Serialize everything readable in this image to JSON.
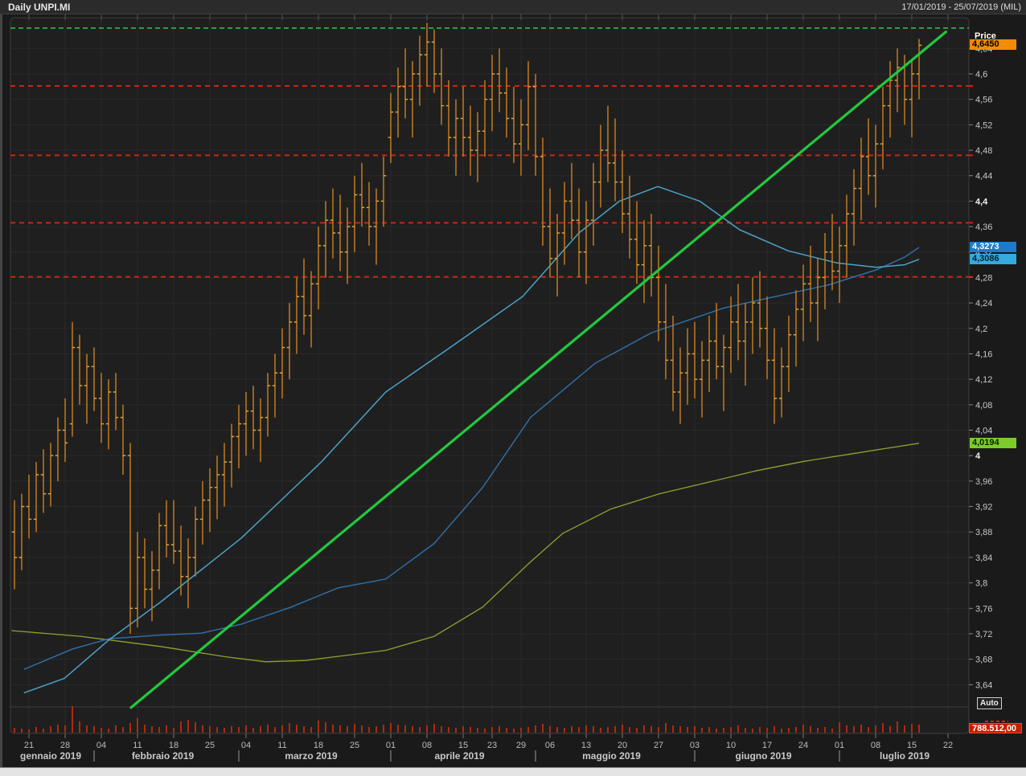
{
  "titlebar": {
    "title": "Daily UNPI.MI",
    "range": "17/01/2019 - 25/07/2019 (MIL)"
  },
  "readouts": {
    "price_label": "Price",
    "last_price": "4,6450",
    "ma_steel": "4,3273",
    "ma_cyan": "4,3086",
    "ma_olive": "4,0194",
    "last_volume": "788.512,00"
  },
  "controls": {
    "auto": "Auto"
  },
  "colors": {
    "plot_bg": "#1f1f1f",
    "frame": "#3d3d3d",
    "grid": "#2a2a2a",
    "bar": "#c07a1e",
    "bar_tick": "#dca43c",
    "volume": "#ae2a10",
    "ma_cyan": "#4aa3c8",
    "ma_steel": "#2e6da4",
    "ma_olive": "#8fa32f",
    "trend": "#21c93e",
    "green_dashed": "#2f9e41",
    "red_dashed": "#c62814",
    "axis_text": "#c8c8c8",
    "tick_mark": "#888888"
  },
  "chart_data": {
    "type": "ohlc",
    "title": "Daily UNPI.MI",
    "x_range": "17/01/2019 - 25/07/2019",
    "y_axis": {
      "min": 3.64,
      "max": 4.64,
      "ticks": [
        {
          "v": 4.64,
          "t": "4,64"
        },
        {
          "v": 4.6,
          "t": "4,6"
        },
        {
          "v": 4.56,
          "t": "4,56"
        },
        {
          "v": 4.52,
          "t": "4,52"
        },
        {
          "v": 4.48,
          "t": "4,48"
        },
        {
          "v": 4.44,
          "t": "4,44"
        },
        {
          "v": 4.4,
          "t": "4,4",
          "b": 1
        },
        {
          "v": 4.36,
          "t": "4,36"
        },
        {
          "v": 4.32,
          "t": "4,32"
        },
        {
          "v": 4.28,
          "t": "4,28"
        },
        {
          "v": 4.24,
          "t": "4,24"
        },
        {
          "v": 4.2,
          "t": "4,2"
        },
        {
          "v": 4.16,
          "t": "4,16"
        },
        {
          "v": 4.12,
          "t": "4,12"
        },
        {
          "v": 4.08,
          "t": "4,08"
        },
        {
          "v": 4.04,
          "t": "4,04"
        },
        {
          "v": 4.0,
          "t": "4",
          "b": 1
        },
        {
          "v": 3.96,
          "t": "3,96"
        },
        {
          "v": 3.92,
          "t": "3,92"
        },
        {
          "v": 3.88,
          "t": "3,88"
        },
        {
          "v": 3.84,
          "t": "3,84"
        },
        {
          "v": 3.8,
          "t": "3,8"
        },
        {
          "v": 3.76,
          "t": "3,76"
        },
        {
          "v": 3.72,
          "t": "3,72"
        },
        {
          "v": 3.68,
          "t": "3,68"
        },
        {
          "v": 3.64,
          "t": "3,64"
        }
      ]
    },
    "x_axis": {
      "week_ticks": [
        [
          "21",
          2
        ],
        [
          "28",
          7
        ],
        [
          "04",
          12
        ],
        [
          "11",
          17
        ],
        [
          "18",
          22
        ],
        [
          "25",
          27
        ],
        [
          "04",
          32
        ],
        [
          "11",
          37
        ],
        [
          "18",
          42
        ],
        [
          "25",
          47
        ],
        [
          "01",
          52
        ],
        [
          "08",
          57
        ],
        [
          "15",
          62
        ],
        [
          "23",
          66
        ],
        [
          "29",
          70
        ],
        [
          "06",
          74
        ],
        [
          "13",
          79
        ],
        [
          "20",
          84
        ],
        [
          "27",
          89
        ],
        [
          "03",
          94
        ],
        [
          "10",
          99
        ],
        [
          "17",
          104
        ],
        [
          "24",
          109
        ],
        [
          "01",
          114
        ],
        [
          "08",
          119
        ],
        [
          "15",
          124
        ],
        [
          "22",
          129
        ]
      ],
      "months": [
        {
          "label": "gennaio 2019",
          "start": 0,
          "end": 10
        },
        {
          "label": "febbraio 2019",
          "start": 11,
          "end": 30
        },
        {
          "label": "marzo 2019",
          "start": 31,
          "end": 51
        },
        {
          "label": "aprile 2019",
          "start": 52,
          "end": 71
        },
        {
          "label": "maggio 2019",
          "start": 72,
          "end": 93
        },
        {
          "label": "giugno 2019",
          "start": 94,
          "end": 113
        },
        {
          "label": "luglio 2019",
          "start": 114,
          "end": 132
        }
      ],
      "total_slots": 133
    },
    "bars": [
      [
        3.88,
        3.93,
        3.79,
        3.84
      ],
      [
        3.84,
        3.94,
        3.82,
        3.92
      ],
      [
        3.92,
        3.97,
        3.87,
        3.9
      ],
      [
        3.9,
        3.99,
        3.88,
        3.97
      ],
      [
        3.97,
        4.01,
        3.91,
        3.94
      ],
      [
        3.94,
        4.02,
        3.92,
        4.0
      ],
      [
        4.0,
        4.06,
        3.96,
        4.04
      ],
      [
        4.04,
        4.09,
        3.99,
        4.02
      ],
      [
        4.05,
        4.21,
        4.03,
        4.17
      ],
      [
        4.17,
        4.19,
        4.08,
        4.11
      ],
      [
        4.11,
        4.16,
        4.05,
        4.14
      ],
      [
        4.14,
        4.17,
        4.07,
        4.09
      ],
      [
        4.09,
        4.13,
        4.02,
        4.05
      ],
      [
        4.05,
        4.12,
        4.01,
        4.1
      ],
      [
        4.1,
        4.13,
        4.04,
        4.06
      ],
      [
        4.06,
        4.08,
        3.97,
        4.0
      ],
      [
        4.0,
        4.02,
        3.72,
        3.76
      ],
      [
        3.76,
        3.88,
        3.73,
        3.84
      ],
      [
        3.84,
        3.87,
        3.76,
        3.79
      ],
      [
        3.79,
        3.85,
        3.74,
        3.82
      ],
      [
        3.82,
        3.91,
        3.79,
        3.89
      ],
      [
        3.89,
        3.93,
        3.84,
        3.86
      ],
      [
        3.86,
        3.93,
        3.83,
        3.85
      ],
      [
        3.85,
        3.89,
        3.78,
        3.81
      ],
      [
        3.81,
        3.87,
        3.76,
        3.84
      ],
      [
        3.84,
        3.92,
        3.81,
        3.9
      ],
      [
        3.9,
        3.96,
        3.86,
        3.93
      ],
      [
        3.93,
        3.98,
        3.88,
        3.95
      ],
      [
        3.95,
        4.0,
        3.9,
        3.97
      ],
      [
        3.97,
        4.02,
        3.92,
        3.99
      ],
      [
        3.99,
        4.05,
        3.95,
        4.03
      ],
      [
        4.03,
        4.08,
        3.98,
        4.05
      ],
      [
        4.05,
        4.1,
        4.0,
        4.07
      ],
      [
        4.07,
        4.11,
        4.01,
        4.04
      ],
      [
        4.04,
        4.09,
        3.99,
        4.06
      ],
      [
        4.06,
        4.13,
        4.03,
        4.11
      ],
      [
        4.11,
        4.16,
        4.06,
        4.13
      ],
      [
        4.13,
        4.2,
        4.09,
        4.17
      ],
      [
        4.17,
        4.24,
        4.12,
        4.21
      ],
      [
        4.21,
        4.28,
        4.16,
        4.25
      ],
      [
        4.25,
        4.31,
        4.19,
        4.22
      ],
      [
        4.22,
        4.29,
        4.17,
        4.27
      ],
      [
        4.27,
        4.36,
        4.23,
        4.33
      ],
      [
        4.33,
        4.4,
        4.28,
        4.37
      ],
      [
        4.37,
        4.42,
        4.31,
        4.35
      ],
      [
        4.35,
        4.41,
        4.29,
        4.32
      ],
      [
        4.32,
        4.39,
        4.27,
        4.36
      ],
      [
        4.36,
        4.44,
        4.32,
        4.41
      ],
      [
        4.41,
        4.46,
        4.36,
        4.39
      ],
      [
        4.39,
        4.43,
        4.33,
        4.36
      ],
      [
        4.36,
        4.42,
        4.3,
        4.4
      ],
      [
        4.4,
        4.47,
        4.36,
        4.44
      ],
      [
        4.5,
        4.57,
        4.46,
        4.54
      ],
      [
        4.54,
        4.61,
        4.5,
        4.58
      ],
      [
        4.58,
        4.64,
        4.53,
        4.56
      ],
      [
        4.56,
        4.62,
        4.5,
        4.6
      ],
      [
        4.6,
        4.66,
        4.55,
        4.63
      ],
      [
        4.63,
        4.68,
        4.58,
        4.65
      ],
      [
        4.65,
        4.67,
        4.57,
        4.6
      ],
      [
        4.6,
        4.64,
        4.52,
        4.55
      ],
      [
        4.55,
        4.59,
        4.47,
        4.5
      ],
      [
        4.5,
        4.56,
        4.44,
        4.53
      ],
      [
        4.53,
        4.58,
        4.47,
        4.5
      ],
      [
        4.5,
        4.55,
        4.44,
        4.48
      ],
      [
        4.48,
        4.54,
        4.43,
        4.51
      ],
      [
        4.51,
        4.59,
        4.47,
        4.56
      ],
      [
        4.56,
        4.63,
        4.51,
        4.6
      ],
      [
        4.6,
        4.64,
        4.54,
        4.57
      ],
      [
        4.57,
        4.61,
        4.5,
        4.53
      ],
      [
        4.53,
        4.58,
        4.46,
        4.49
      ],
      [
        4.49,
        4.56,
        4.44,
        4.52
      ],
      [
        4.52,
        4.62,
        4.48,
        4.58
      ],
      [
        4.58,
        4.6,
        4.44,
        4.47
      ],
      [
        4.47,
        4.5,
        4.33,
        4.36
      ],
      [
        4.36,
        4.42,
        4.28,
        4.31
      ],
      [
        4.31,
        4.38,
        4.25,
        4.35
      ],
      [
        4.35,
        4.43,
        4.3,
        4.4
      ],
      [
        4.4,
        4.46,
        4.34,
        4.37
      ],
      [
        4.37,
        4.42,
        4.28,
        4.32
      ],
      [
        4.32,
        4.4,
        4.27,
        4.37
      ],
      [
        4.37,
        4.46,
        4.33,
        4.43
      ],
      [
        4.43,
        4.52,
        4.39,
        4.48
      ],
      [
        4.48,
        4.55,
        4.43,
        4.46
      ],
      [
        4.46,
        4.53,
        4.4,
        4.43
      ],
      [
        4.43,
        4.48,
        4.35,
        4.38
      ],
      [
        4.38,
        4.44,
        4.31,
        4.34
      ],
      [
        4.34,
        4.4,
        4.27,
        4.3
      ],
      [
        4.3,
        4.37,
        4.24,
        4.33
      ],
      [
        4.33,
        4.38,
        4.25,
        4.28
      ],
      [
        4.28,
        4.33,
        4.18,
        4.21
      ],
      [
        4.21,
        4.27,
        4.12,
        4.15
      ],
      [
        4.15,
        4.22,
        4.07,
        4.1
      ],
      [
        4.1,
        4.17,
        4.05,
        4.13
      ],
      [
        4.13,
        4.2,
        4.08,
        4.16
      ],
      [
        4.16,
        4.21,
        4.09,
        4.12
      ],
      [
        4.12,
        4.18,
        4.06,
        4.15
      ],
      [
        4.15,
        4.22,
        4.1,
        4.18
      ],
      [
        4.18,
        4.24,
        4.12,
        4.14
      ],
      [
        4.14,
        4.19,
        4.07,
        4.17
      ],
      [
        4.17,
        4.25,
        4.13,
        4.21
      ],
      [
        4.21,
        4.27,
        4.15,
        4.18
      ],
      [
        4.18,
        4.24,
        4.11,
        4.21
      ],
      [
        4.21,
        4.28,
        4.16,
        4.24
      ],
      [
        4.24,
        4.29,
        4.17,
        4.2
      ],
      [
        4.2,
        4.25,
        4.12,
        4.15
      ],
      [
        4.15,
        4.2,
        4.05,
        4.09
      ],
      [
        4.09,
        4.17,
        4.06,
        4.14
      ],
      [
        4.14,
        4.22,
        4.1,
        4.19
      ],
      [
        4.19,
        4.26,
        4.14,
        4.23
      ],
      [
        4.23,
        4.3,
        4.18,
        4.27
      ],
      [
        4.27,
        4.33,
        4.21,
        4.24
      ],
      [
        4.24,
        4.31,
        4.18,
        4.28
      ],
      [
        4.28,
        4.35,
        4.23,
        4.32
      ],
      [
        4.32,
        4.38,
        4.26,
        4.29
      ],
      [
        4.29,
        4.36,
        4.24,
        4.33
      ],
      [
        4.33,
        4.41,
        4.28,
        4.38
      ],
      [
        4.38,
        4.45,
        4.33,
        4.42
      ],
      [
        4.42,
        4.5,
        4.37,
        4.47
      ],
      [
        4.47,
        4.53,
        4.41,
        4.44
      ],
      [
        4.44,
        4.52,
        4.39,
        4.49
      ],
      [
        4.49,
        4.58,
        4.45,
        4.55
      ],
      [
        4.55,
        4.62,
        4.5,
        4.59
      ],
      [
        4.59,
        4.64,
        4.54,
        4.61
      ],
      [
        4.61,
        4.63,
        4.52,
        4.56
      ],
      [
        4.56,
        4.62,
        4.5,
        4.6
      ],
      [
        4.6,
        4.655,
        4.56,
        4.645
      ]
    ],
    "volume_rel": [
      6,
      5,
      4,
      7,
      5,
      8,
      10,
      9,
      33,
      14,
      9,
      8,
      6,
      5,
      9,
      7,
      12,
      18,
      10,
      8,
      7,
      9,
      6,
      14,
      16,
      13,
      9,
      8,
      7,
      6,
      8,
      7,
      9,
      6,
      8,
      10,
      7,
      9,
      12,
      10,
      8,
      7,
      15,
      13,
      10,
      9,
      8,
      11,
      9,
      7,
      8,
      10,
      12,
      10,
      9,
      8,
      7,
      9,
      11,
      8,
      7,
      6,
      8,
      7,
      6,
      5,
      7,
      8,
      6,
      5,
      6,
      7,
      9,
      11,
      8,
      7,
      6,
      8,
      7,
      9,
      8,
      6,
      7,
      8,
      10,
      7,
      6,
      9,
      8,
      7,
      12,
      9,
      8,
      7,
      8,
      6,
      7,
      5,
      6,
      7,
      9,
      6,
      5,
      7,
      6,
      8,
      5,
      6,
      7,
      10,
      8,
      6,
      7,
      5,
      13,
      9,
      8,
      10,
      7,
      9,
      12,
      8,
      14,
      9,
      11,
      10
    ],
    "overlays": {
      "ma_cyan": {
        "last_label": "4,3086",
        "points": [
          [
            1.3,
            3.627
          ],
          [
            6.9,
            3.65
          ],
          [
            13,
            3.71
          ],
          [
            20.2,
            3.77
          ],
          [
            31.3,
            3.87
          ],
          [
            42.4,
            3.99
          ],
          [
            51.3,
            4.1
          ],
          [
            60.2,
            4.17
          ],
          [
            70.2,
            4.25
          ],
          [
            78,
            4.35
          ],
          [
            83.6,
            4.4
          ],
          [
            88.9,
            4.423
          ],
          [
            94.7,
            4.4
          ],
          [
            100.2,
            4.355
          ],
          [
            106.9,
            4.322
          ],
          [
            113.6,
            4.303
          ],
          [
            119.1,
            4.296
          ],
          [
            123,
            4.3
          ],
          [
            125,
            4.3086
          ]
        ]
      },
      "ma_steel": {
        "last_label": "4,3273",
        "points": [
          [
            1.3,
            3.664
          ],
          [
            8,
            3.696
          ],
          [
            13,
            3.712
          ],
          [
            20.2,
            3.718
          ],
          [
            25.8,
            3.721
          ],
          [
            31.3,
            3.735
          ],
          [
            38,
            3.761
          ],
          [
            44.7,
            3.792
          ],
          [
            51.3,
            3.806
          ],
          [
            58,
            3.862
          ],
          [
            64.7,
            3.95
          ],
          [
            71.3,
            4.06
          ],
          [
            80.2,
            4.145
          ],
          [
            88,
            4.193
          ],
          [
            98,
            4.232
          ],
          [
            104.7,
            4.249
          ],
          [
            112.4,
            4.268
          ],
          [
            119.1,
            4.292
          ],
          [
            123,
            4.312
          ],
          [
            125,
            4.3273
          ]
        ]
      },
      "ma_olive": {
        "last_label": "4,0194",
        "points": [
          [
            -0.4,
            3.725
          ],
          [
            9.1,
            3.716
          ],
          [
            20.2,
            3.7
          ],
          [
            29.1,
            3.684
          ],
          [
            34.7,
            3.676
          ],
          [
            40.2,
            3.678
          ],
          [
            45.8,
            3.686
          ],
          [
            51.3,
            3.694
          ],
          [
            58,
            3.716
          ],
          [
            64.7,
            3.762
          ],
          [
            71.3,
            3.833
          ],
          [
            75.8,
            3.878
          ],
          [
            82.4,
            3.916
          ],
          [
            89.1,
            3.94
          ],
          [
            95.8,
            3.958
          ],
          [
            102.4,
            3.976
          ],
          [
            109.1,
            3.991
          ],
          [
            115.8,
            4.003
          ],
          [
            120.2,
            4.011
          ],
          [
            125,
            4.0194
          ]
        ]
      },
      "trend_line": {
        "from": [
          16.1,
          3.604
        ],
        "to": [
          128.7,
          4.666
        ]
      },
      "green_dashed_level": 4.672,
      "red_dashed_levels": [
        4.581,
        4.472,
        4.366,
        4.281
      ]
    },
    "last_price": 4.645,
    "last_volume_label": "788.512,00"
  }
}
